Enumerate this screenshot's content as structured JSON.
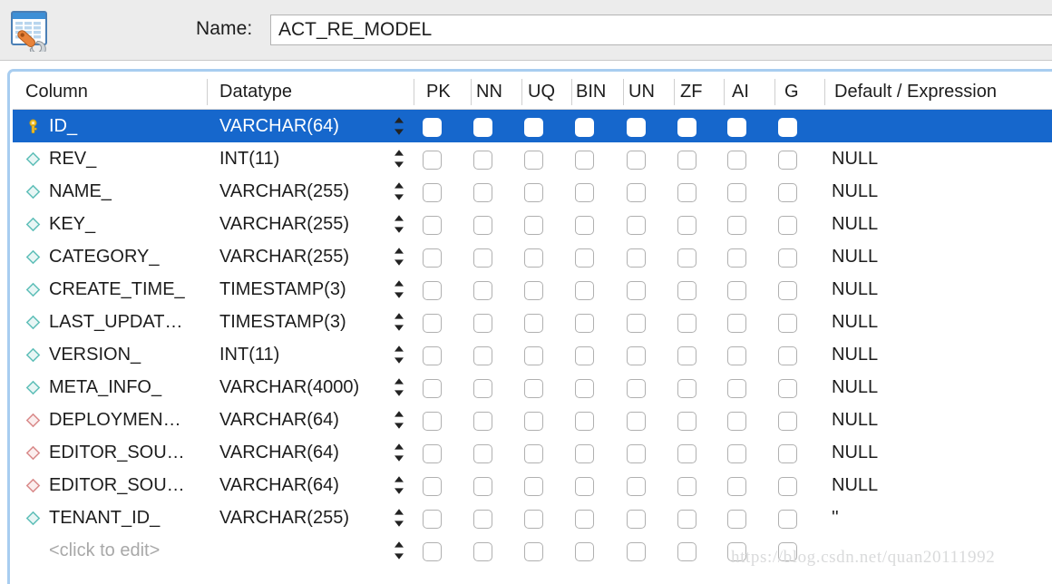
{
  "toolbar": {
    "icon": "table-wrench-icon",
    "name_label": "Name:",
    "name_value": "ACT_RE_MODEL",
    "name_placeholder": ""
  },
  "grid": {
    "headers": {
      "column": "Column",
      "datatype": "Datatype",
      "pk": "PK",
      "nn": "NN",
      "uq": "UQ",
      "bin": "BIN",
      "un": "UN",
      "zf": "ZF",
      "ai": "AI",
      "g": "G",
      "default": "Default / Expression"
    },
    "flag_keys": [
      "pk",
      "nn",
      "uq",
      "bin",
      "un",
      "zf",
      "ai",
      "g"
    ],
    "rows": [
      {
        "icon": "primary-key-icon",
        "name": "ID_",
        "datatype": "VARCHAR(64)",
        "pk": true,
        "nn": true,
        "uq": false,
        "bin": false,
        "un": false,
        "zf": false,
        "ai": false,
        "g": false,
        "default": "",
        "selected": true
      },
      {
        "icon": "column-diamond-icon",
        "name": "REV_",
        "datatype": "INT(11)",
        "pk": false,
        "nn": false,
        "uq": false,
        "bin": false,
        "un": false,
        "zf": false,
        "ai": false,
        "g": false,
        "default": "NULL",
        "selected": false
      },
      {
        "icon": "column-diamond-icon",
        "name": "NAME_",
        "datatype": "VARCHAR(255)",
        "pk": false,
        "nn": false,
        "uq": false,
        "bin": false,
        "un": false,
        "zf": false,
        "ai": false,
        "g": false,
        "default": "NULL",
        "selected": false
      },
      {
        "icon": "column-diamond-icon",
        "name": "KEY_",
        "datatype": "VARCHAR(255)",
        "pk": false,
        "nn": false,
        "uq": false,
        "bin": false,
        "un": false,
        "zf": false,
        "ai": false,
        "g": false,
        "default": "NULL",
        "selected": false
      },
      {
        "icon": "column-diamond-icon",
        "name": "CATEGORY_",
        "datatype": "VARCHAR(255)",
        "pk": false,
        "nn": false,
        "uq": false,
        "bin": false,
        "un": false,
        "zf": false,
        "ai": false,
        "g": false,
        "default": "NULL",
        "selected": false
      },
      {
        "icon": "column-diamond-icon",
        "name": "CREATE_TIME_",
        "datatype": "TIMESTAMP(3)",
        "pk": false,
        "nn": false,
        "uq": false,
        "bin": false,
        "un": false,
        "zf": false,
        "ai": false,
        "g": false,
        "default": "NULL",
        "selected": false
      },
      {
        "icon": "column-diamond-icon",
        "name": "LAST_UPDAT…",
        "datatype": "TIMESTAMP(3)",
        "pk": false,
        "nn": false,
        "uq": false,
        "bin": false,
        "un": false,
        "zf": false,
        "ai": false,
        "g": false,
        "default": "NULL",
        "selected": false
      },
      {
        "icon": "column-diamond-icon",
        "name": "VERSION_",
        "datatype": "INT(11)",
        "pk": false,
        "nn": false,
        "uq": false,
        "bin": false,
        "un": false,
        "zf": false,
        "ai": false,
        "g": false,
        "default": "NULL",
        "selected": false
      },
      {
        "icon": "column-diamond-icon",
        "name": "META_INFO_",
        "datatype": "VARCHAR(4000)",
        "pk": false,
        "nn": false,
        "uq": false,
        "bin": false,
        "un": false,
        "zf": false,
        "ai": false,
        "g": false,
        "default": "NULL",
        "selected": false
      },
      {
        "icon": "foreign-key-diamond-icon",
        "name": "DEPLOYMEN…",
        "datatype": "VARCHAR(64)",
        "pk": false,
        "nn": false,
        "uq": false,
        "bin": false,
        "un": false,
        "zf": false,
        "ai": false,
        "g": false,
        "default": "NULL",
        "selected": false
      },
      {
        "icon": "foreign-key-diamond-icon",
        "name": "EDITOR_SOU…",
        "datatype": "VARCHAR(64)",
        "pk": false,
        "nn": false,
        "uq": false,
        "bin": false,
        "un": false,
        "zf": false,
        "ai": false,
        "g": false,
        "default": "NULL",
        "selected": false
      },
      {
        "icon": "foreign-key-diamond-icon",
        "name": "EDITOR_SOU…",
        "datatype": "VARCHAR(64)",
        "pk": false,
        "nn": false,
        "uq": false,
        "bin": false,
        "un": false,
        "zf": false,
        "ai": false,
        "g": false,
        "default": "NULL",
        "selected": false
      },
      {
        "icon": "column-diamond-icon",
        "name": "TENANT_ID_",
        "datatype": "VARCHAR(255)",
        "pk": false,
        "nn": false,
        "uq": false,
        "bin": false,
        "un": false,
        "zf": false,
        "ai": false,
        "g": false,
        "default": "''",
        "selected": false
      },
      {
        "icon": "none",
        "name": "<click to edit>",
        "datatype": "",
        "pk": false,
        "nn": false,
        "uq": false,
        "bin": false,
        "un": false,
        "zf": false,
        "ai": false,
        "g": false,
        "default": "",
        "selected": false,
        "placeholder": true
      }
    ]
  },
  "watermark": {
    "text": "https://blog.csdn.net/quan20111992"
  },
  "colors": {
    "selection_blue": "#1667cc",
    "checkbox_blue": "#4f9bf2",
    "focus_ring": "#a8cdf0",
    "toolbar_gray": "#ececec",
    "key_yellow": "#f2c230",
    "diamond_teal": "#5fbfb8",
    "diamond_red": "#d98a8a"
  }
}
